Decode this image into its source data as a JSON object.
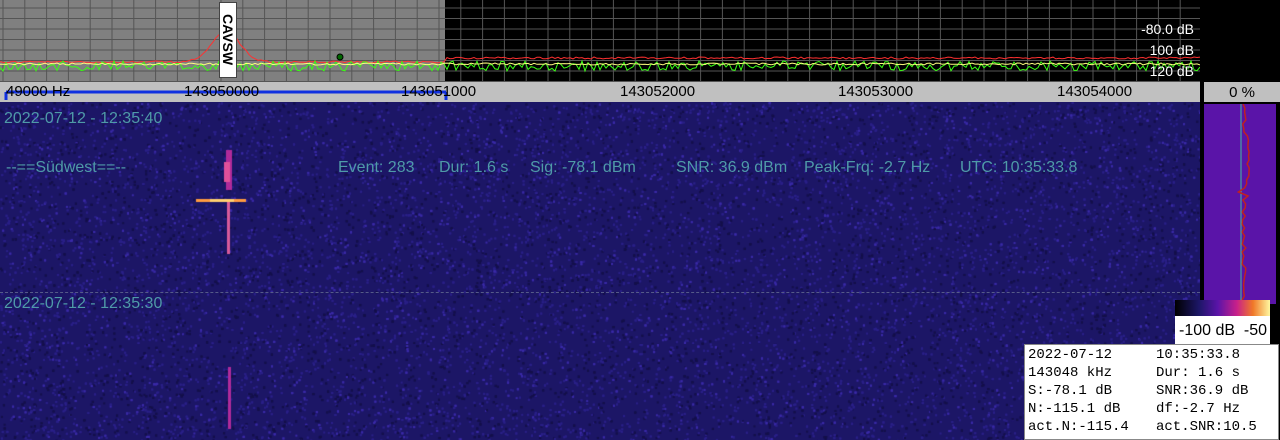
{
  "spectrum": {
    "db_labels": [
      "-80.0 dB",
      "100 dB",
      "120 dB"
    ],
    "marker_label": "CAVSW",
    "colors": {
      "trace": "#39ff14",
      "peak": "#ff3030",
      "grid": "#555555",
      "selection": "#808080"
    }
  },
  "freq_axis": {
    "ticks": [
      "49000 Hz",
      "143050000",
      "143051000",
      "143052000",
      "143053000",
      "143054000"
    ],
    "zoom": "0 %"
  },
  "waterfall": {
    "timestamp_top": "2022-07-12 - 12:35:40",
    "timestamp_bottom": "2022-07-12 - 12:35:30",
    "station": "--==Südwest==--",
    "event": {
      "event": "Event: 283",
      "dur": "Dur: 1.6 s",
      "sig": "Sig: -78.1 dBm",
      "snr": "SNR: 36.9 dBm",
      "peak": "Peak-Frq: -2.7 Hz",
      "utc": "UTC: 10:35:33.8"
    },
    "colors": {
      "background": "#1c1666",
      "text": "#4f9aa8",
      "signal": "#ff9a40"
    }
  },
  "scale": {
    "min": "-100 dB",
    "max": "-50"
  },
  "info": {
    "date": "2022-07-12",
    "time": "10:35:33.8",
    "freq": "143048 kHz",
    "dur": "Dur: 1.6 s",
    "s": "S:-78.1 dB",
    "snr": "SNR:36.9 dB",
    "n": "N:-115.1 dB",
    "df": "df:-2.7 Hz",
    "act_n": "act.N:-115.4",
    "act_snr": "act.SNR:10.5"
  }
}
